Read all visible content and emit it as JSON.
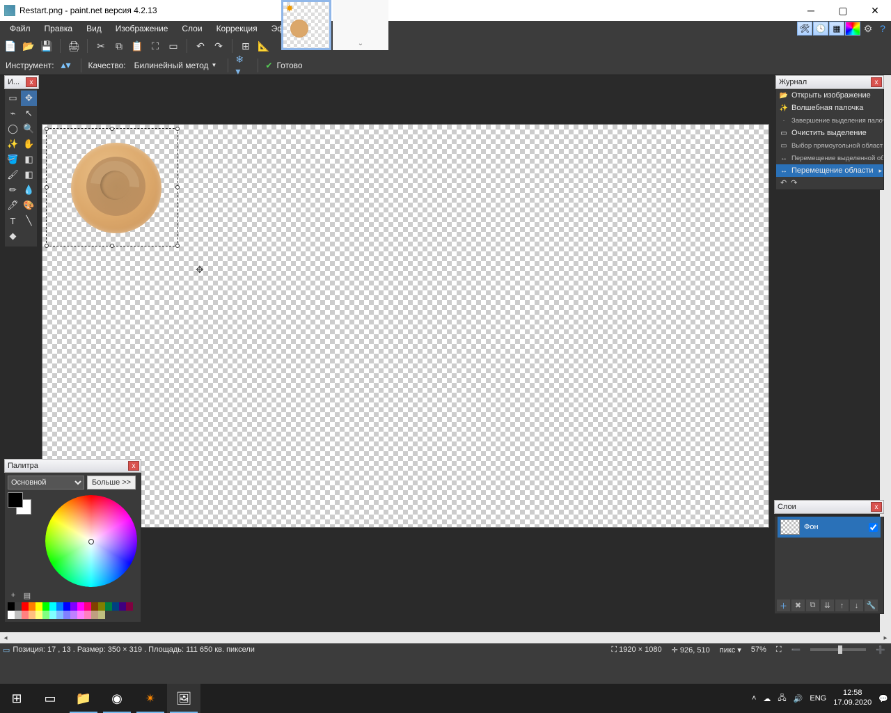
{
  "title": "Restart.png - paint.net версия 4.2.13",
  "menu": [
    "Файл",
    "Правка",
    "Вид",
    "Изображение",
    "Слои",
    "Коррекция",
    "Эффекты"
  ],
  "toolbar2": {
    "tool_label": "Инструмент:",
    "quality_label": "Качество:",
    "quality_value": "Билинейный метод",
    "status": "Готово"
  },
  "tools_panel": {
    "title": "И..."
  },
  "history": {
    "title": "Журнал",
    "items": [
      {
        "label": "Открыть изображение",
        "small": false,
        "icon": "📂"
      },
      {
        "label": "Волшебная палочка",
        "small": false,
        "icon": "✨"
      },
      {
        "label": "Завершение выделения палочкой",
        "small": true,
        "icon": "·"
      },
      {
        "label": "Очистить выделение",
        "small": false,
        "icon": "▭"
      },
      {
        "label": "Выбор прямоугольной области",
        "small": true,
        "icon": "▭"
      },
      {
        "label": "Перемещение выделенной области",
        "small": true,
        "icon": "↔"
      },
      {
        "label": "Перемещение области",
        "small": false,
        "icon": "↔",
        "hl": true
      }
    ]
  },
  "layers": {
    "title": "Слои",
    "items": [
      {
        "name": "Фон",
        "checked": true
      }
    ]
  },
  "palette": {
    "title": "Палитра",
    "mode": "Основной",
    "more": "Больше >>"
  },
  "status": {
    "position": "Позиция: 17 , 13 . Размер: 350  × 319 . Площадь: 111 650 кв. пиксели",
    "dim": "1920 × 1080",
    "cursor": "926, 510",
    "unit": "пикс",
    "zoom": "57%"
  },
  "tray": {
    "lang": "ENG",
    "time": "12:58",
    "date": "17.09.2020"
  },
  "palette_colors": [
    "#000",
    "#404040",
    "#f00",
    "#ff7f00",
    "#ff0",
    "#0f0",
    "#0ff",
    "#007fff",
    "#00f",
    "#7f00ff",
    "#f0f",
    "#ff007f",
    "#804000",
    "#808000",
    "#008040",
    "#004080",
    "#400080",
    "#800040",
    "#fff",
    "#c0c0c0",
    "#ff8080",
    "#ffbf80",
    "#ffff80",
    "#80ff80",
    "#80ffff",
    "#80bfff",
    "#8080ff",
    "#bf80ff",
    "#ff80ff",
    "#ff80bf",
    "#bf9f80",
    "#bfbf80"
  ]
}
